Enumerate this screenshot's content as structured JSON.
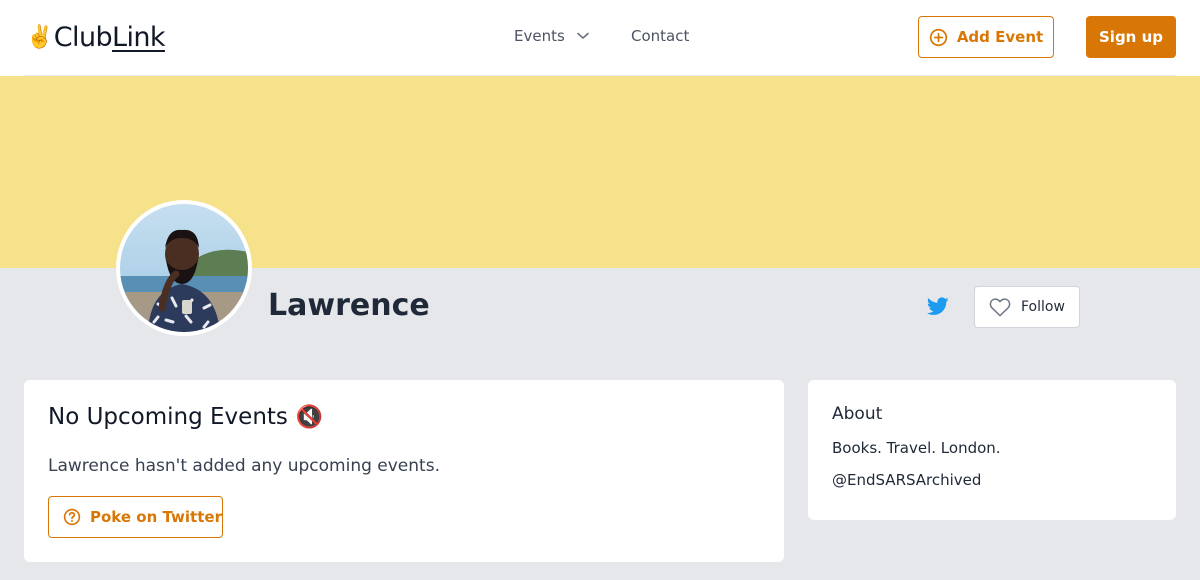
{
  "header": {
    "logo": {
      "emoji": "✌️",
      "part1": "Club",
      "part2": "Link"
    },
    "nav": {
      "events": "Events",
      "contact": "Contact"
    },
    "add_event": "Add Event",
    "sign_up": "Sign up"
  },
  "profile": {
    "name": "Lawrence",
    "follow": "Follow",
    "twitter_icon": "twitter-icon"
  },
  "events": {
    "title": "No Upcoming Events",
    "title_emoji": "🔇",
    "message": "Lawrence hasn't added any upcoming events.",
    "poke": "Poke on Twitter"
  },
  "about": {
    "title": "About",
    "bio": "Books. Travel. London.",
    "handle": "@EndSARSArchived"
  },
  "colors": {
    "accent": "#d97706",
    "banner": "#f6e28b",
    "page_bg": "#e5e7eb",
    "twitter": "#1d9bf0"
  }
}
